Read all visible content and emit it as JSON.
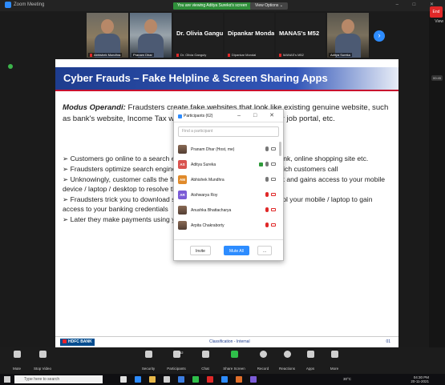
{
  "window": {
    "title": "Zoom Meeting",
    "controls": "–  □  ✕"
  },
  "banner": {
    "text": "You are viewing Aditya Surekα's screen",
    "view_options": "View Options ⌄"
  },
  "right_panel": {
    "view_label": "View",
    "time_pill": "00:45"
  },
  "videos": [
    {
      "name": "Abhishek Mundhra"
    },
    {
      "name": "Pranam Dhar"
    },
    {
      "display": "Dr. Olivia Ganguly",
      "name": "Dr. Olivia Ganguly"
    },
    {
      "display": "Dipankar Mondal",
      "name": "Dipankar Mondal"
    },
    {
      "display": "MANAS's M52",
      "name": "MANAS's M52"
    },
    {
      "name": "Aditya Sureka"
    }
  ],
  "slide": {
    "title": "Cyber Frauds – Fake Helpline & Screen Sharing Apps",
    "modus_label": "Modus Operandi:",
    "modus_text": " Fraudsters create fake websites that look like existing genuine website, such as bank's website, Income Tax website, through search engine or job portal, etc.",
    "bullets": [
      "➢ Customers go online to a search engine to find helpline number for bank, online shopping site etc.",
      "➢ Fraudsters optimize search engines to show their fake helpline no. which customers call",
      "➢ Unknowingly, customer calls the fraudsters pretending to be your bank and gains access to your mobile device / laptop / desktop to resolve the issue",
      "➢ Fraudsters trick you to download screen sharing apps to watch / control your mobile / laptop to gain access to your banking credentials",
      "➢ Later they make payments using your account"
    ],
    "footer_logo": "HDFC BANK",
    "classification": "Classification - Internal",
    "page": "01"
  },
  "participants": {
    "title": "Participants (62)",
    "controls": "–  □  ✕",
    "search_placeholder": "Find a participant",
    "list": [
      {
        "initials": "",
        "name": "Pranam Dhar (Host, me)",
        "mic": "on",
        "cam": "on",
        "share": false
      },
      {
        "initials": "AS",
        "name": "Aditya Sureka",
        "mic": "on",
        "cam": "on",
        "share": true,
        "color": "#d9534f"
      },
      {
        "initials": "AM",
        "name": "Abhishek Mundhra",
        "mic": "on",
        "cam": "on",
        "share": false,
        "color": "#e08a2a"
      },
      {
        "initials": "AR",
        "name": "Aishwarya Roy",
        "mic": "muted",
        "cam": "off",
        "share": false,
        "color": "#7b5bd6"
      },
      {
        "initials": "",
        "name": "Anushka Bhattacharya",
        "mic": "muted",
        "cam": "off",
        "share": false
      },
      {
        "initials": "",
        "name": "Arpita Chakraborty",
        "mic": "muted",
        "cam": "off",
        "share": false
      }
    ],
    "invite_label": "Invite",
    "mute_all_label": "Mute All",
    "more_label": "..."
  },
  "toolbar": {
    "items": [
      {
        "label": "Mute"
      },
      {
        "label": "Stop Video"
      },
      {
        "label": "Security"
      },
      {
        "label": "Participants",
        "count": "62"
      },
      {
        "label": "Chat"
      },
      {
        "label": "Share Screen"
      },
      {
        "label": "Record"
      },
      {
        "label": "Reactions"
      },
      {
        "label": "Apps"
      },
      {
        "label": "More"
      }
    ],
    "end_label": "End"
  },
  "taskbar": {
    "search_placeholder": "Type here to search",
    "temperature": "30°C",
    "time": "04:30 PM",
    "date": "20-11-2021",
    "app_colors": [
      "#e0e0e0",
      "#2d8cff",
      "#e8b84a",
      "#cfcfcf",
      "#3c7de0",
      "#2fbf4a",
      "#e02828",
      "#2d8cff",
      "#e06f2a",
      "#7b5bd6"
    ]
  }
}
